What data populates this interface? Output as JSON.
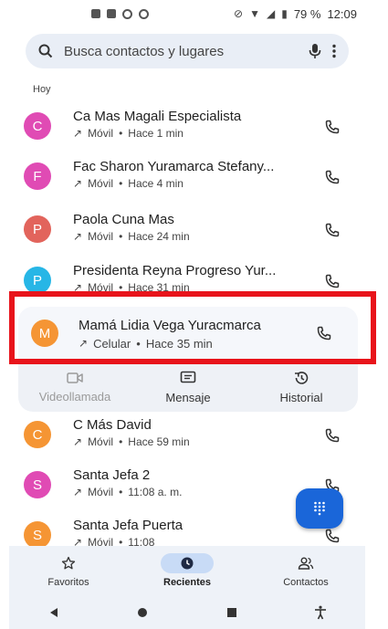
{
  "status_bar": {
    "battery": "79 %",
    "time": "12:09"
  },
  "search": {
    "placeholder": "Busca contactos y lugares"
  },
  "section": {
    "label": "Hoy"
  },
  "calls": [
    {
      "initial": "C",
      "color": "#e04bb4",
      "name": "Ca Mas Magali Especialista",
      "type": "Móvil",
      "time": "Hace 1 min"
    },
    {
      "initial": "F",
      "color": "#e04bb4",
      "name": "Fac Sharon Yuramarca Stefany...",
      "type": "Móvil",
      "time": "Hace 4 min"
    },
    {
      "initial": "P",
      "color": "#e2645c",
      "name": "Paola Cuna Mas",
      "type": "Móvil",
      "time": "Hace 24 min"
    },
    {
      "initial": "P",
      "color": "#27b6e6",
      "name": "Presidenta Reyna Progreso Yur...",
      "type": "Móvil",
      "time": "Hace 31 min"
    }
  ],
  "expanded_call": {
    "initial": "M",
    "color": "#f59534",
    "name": "Mamá Lidia Vega Yuracmarca",
    "type": "Celular",
    "time": "Hace 35 min",
    "actions": [
      {
        "label": "Videollamada",
        "icon": "video-icon",
        "enabled": false
      },
      {
        "label": "Mensaje",
        "icon": "message-icon",
        "enabled": true
      },
      {
        "label": "Historial",
        "icon": "history-icon",
        "enabled": true
      }
    ]
  },
  "calls_after": [
    {
      "initial": "C",
      "color": "#f59534",
      "name": "C Más David",
      "type": "Móvil",
      "time": "Hace 59 min"
    },
    {
      "initial": "S",
      "color": "#e04bb4",
      "name": "Santa Jefa 2",
      "type": "Móvil",
      "time": "11:08 a. m."
    },
    {
      "initial": "S",
      "color": "#f59534",
      "name": "Santa Jefa Puerta",
      "type": "Móvil",
      "time": "11:08"
    }
  ],
  "bottom_nav": [
    {
      "label": "Favoritos",
      "icon": "star-icon",
      "active": false
    },
    {
      "label": "Recientes",
      "icon": "clock-icon",
      "active": true
    },
    {
      "label": "Contactos",
      "icon": "contacts-icon",
      "active": false
    }
  ],
  "colors": {
    "accent": "#1a66d9",
    "highlight": "#e8141b"
  }
}
